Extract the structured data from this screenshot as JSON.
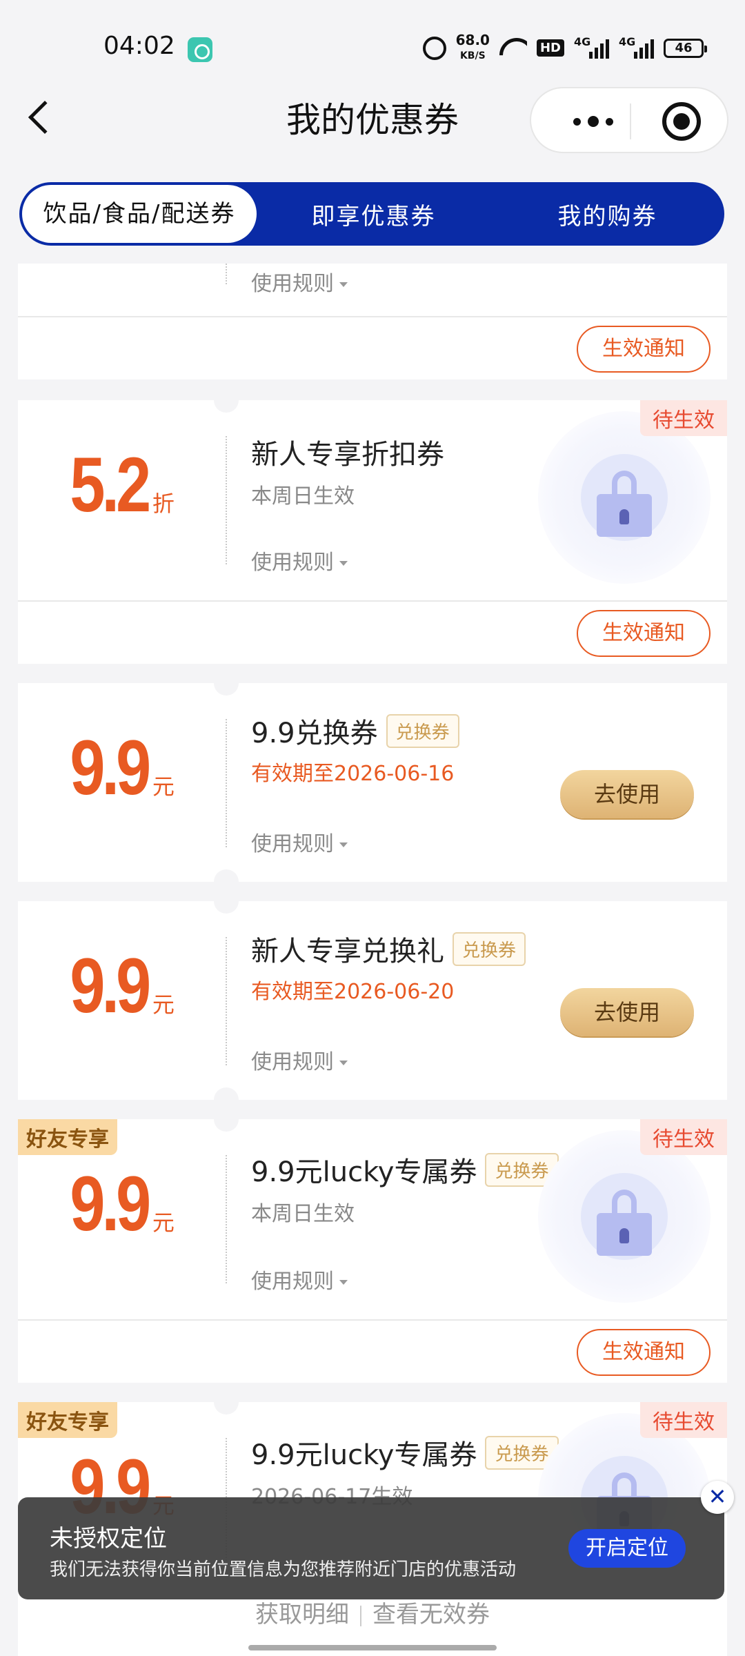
{
  "status_bar": {
    "time": "04:02",
    "net_speed": "68.0",
    "net_unit": "KB/S",
    "hd": "HD",
    "sig1": "4G",
    "sig2": "4G",
    "battery": "46"
  },
  "nav": {
    "title": "我的优惠券"
  },
  "tabs": [
    {
      "label": "饮品/食品/配送券",
      "active": true
    },
    {
      "label": "即享优惠券"
    },
    {
      "label": "我的购券"
    }
  ],
  "common": {
    "rules": "使用规则",
    "notify": "生效通知",
    "use": "去使用",
    "pending": "待生效",
    "friend": "好友专享"
  },
  "coupons": [
    {
      "rules": "使用规则"
    },
    {
      "amount": "5.2",
      "unit": "折",
      "title": "新人专享折扣券",
      "sub": "本周日生效"
    },
    {
      "amount": "9.9",
      "unit": "元",
      "title": "9.9兑换券",
      "tag": "兑换券",
      "sub": "有效期至2026-06-16"
    },
    {
      "amount": "9.9",
      "unit": "元",
      "title": "新人专享兑换礼",
      "tag": "兑换券",
      "sub": "有效期至2026-06-20"
    },
    {
      "amount": "9.9",
      "unit": "元",
      "title": "9.9元lucky专属券",
      "tag": "兑换券",
      "sub": "本周日生效"
    },
    {
      "amount": "9.9",
      "unit": "元",
      "title": "9.9元lucky专属券",
      "tag": "兑换券",
      "sub": "2026-06-17生效"
    }
  ],
  "toast": {
    "title": "未授权定位",
    "message": "我们无法获得你当前位置信息为您推荐附近门店的优惠活动",
    "button": "开启定位",
    "close": "✕"
  },
  "bottom": {
    "details": "获取明细",
    "invalid": "查看无效券"
  }
}
